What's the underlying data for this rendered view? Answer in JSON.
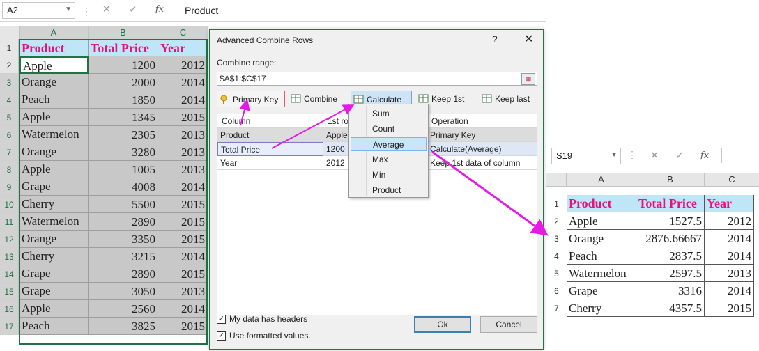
{
  "left_sheet": {
    "name_box": "A2",
    "formula": "Product",
    "columns": [
      "A",
      "B",
      "C"
    ],
    "header_row": {
      "num": "1",
      "cells": [
        "Product",
        "Total Price",
        "Year"
      ]
    },
    "rows": [
      {
        "num": "2",
        "a": "Apple",
        "b": "1200",
        "c": "2012"
      },
      {
        "num": "3",
        "a": "Orange",
        "b": "2000",
        "c": "2014"
      },
      {
        "num": "4",
        "a": "Peach",
        "b": "1850",
        "c": "2014"
      },
      {
        "num": "5",
        "a": "Apple",
        "b": "1345",
        "c": "2015"
      },
      {
        "num": "6",
        "a": "Watermelon",
        "b": "2305",
        "c": "2013"
      },
      {
        "num": "7",
        "a": "Orange",
        "b": "3280",
        "c": "2013"
      },
      {
        "num": "8",
        "a": "Apple",
        "b": "1005",
        "c": "2013"
      },
      {
        "num": "9",
        "a": "Grape",
        "b": "4008",
        "c": "2014"
      },
      {
        "num": "10",
        "a": "Cherry",
        "b": "5500",
        "c": "2015"
      },
      {
        "num": "11",
        "a": "Watermelon",
        "b": "2890",
        "c": "2015"
      },
      {
        "num": "12",
        "a": "Orange",
        "b": "3350",
        "c": "2015"
      },
      {
        "num": "13",
        "a": "Cherry",
        "b": "3215",
        "c": "2014"
      },
      {
        "num": "14",
        "a": "Grape",
        "b": "2890",
        "c": "2015"
      },
      {
        "num": "15",
        "a": "Grape",
        "b": "3050",
        "c": "2013"
      },
      {
        "num": "16",
        "a": "Apple",
        "b": "2560",
        "c": "2014"
      },
      {
        "num": "17",
        "a": "Peach",
        "b": "3825",
        "c": "2015"
      }
    ]
  },
  "dialog": {
    "title": "Advanced Combine Rows",
    "help": "?",
    "close": "✕",
    "combine_range_label": "Combine range:",
    "combine_range_value": "$A$1:$C$17",
    "toolbar": {
      "primary_key": "Primary Key",
      "combine": "Combine",
      "calculate": "Calculate",
      "keep_first": "Keep 1st",
      "keep_last": "Keep last"
    },
    "grid": {
      "headers": [
        "Column",
        "1st ro",
        "Operation"
      ],
      "rows": [
        {
          "column": "Product",
          "first": "Apple",
          "operation": "Primary Key"
        },
        {
          "column": "Total Price",
          "first": "1200",
          "operation": "Calculate(Average)"
        },
        {
          "column": "Year",
          "first": "2012",
          "operation": "Keep 1st data of column"
        }
      ]
    },
    "calc_menu": [
      "Sum",
      "Count",
      "Average",
      "Max",
      "Min",
      "Product"
    ],
    "calc_menu_selected": "Average",
    "my_data_has_headers": "My data has headers",
    "use_formatted_values": "Use formatted values.",
    "ok": "Ok",
    "cancel": "Cancel"
  },
  "right_sheet": {
    "name_box": "S19",
    "columns": [
      "A",
      "B",
      "C"
    ],
    "header_row": {
      "num": "1",
      "cells": [
        "Product",
        "Total Price",
        "Year"
      ]
    },
    "rows": [
      {
        "num": "2",
        "a": "Apple",
        "b": "1527.5",
        "c": "2012"
      },
      {
        "num": "3",
        "a": "Orange",
        "b": "2876.66667",
        "c": "2014"
      },
      {
        "num": "4",
        "a": "Peach",
        "b": "2837.5",
        "c": "2014"
      },
      {
        "num": "5",
        "a": "Watermelon",
        "b": "2597.5",
        "c": "2013"
      },
      {
        "num": "6",
        "a": "Grape",
        "b": "3316",
        "c": "2014"
      },
      {
        "num": "7",
        "a": "Cherry",
        "b": "4357.5",
        "c": "2015"
      }
    ]
  },
  "colors": {
    "header_fill": "#bfe6f7",
    "header_text": "#e8127d",
    "arrow": "#e619e6",
    "excel_green": "#217346"
  }
}
